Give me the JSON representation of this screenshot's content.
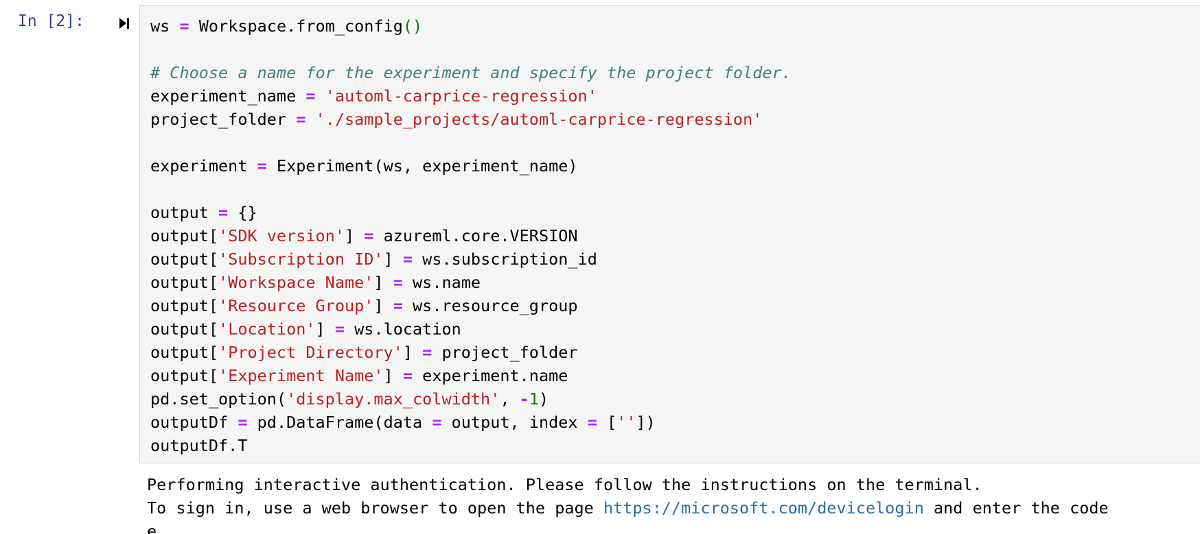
{
  "cell": {
    "prompt": "In [2]:",
    "run_icon": "run-cell-icon"
  },
  "code": {
    "l1": {
      "a": "ws ",
      "op": "=",
      "b": " Workspace.from_config",
      "p": "()"
    },
    "l3": "# Choose a name for the experiment and specify the project folder.",
    "l4": {
      "a": "experiment_name ",
      "op": "=",
      "s": "'automl-carprice-regression'"
    },
    "l5": {
      "a": "project_folder ",
      "op": "=",
      "s": "'./sample_projects/automl-carprice-regression'"
    },
    "l7": {
      "a": "experiment ",
      "op": "=",
      "b": " Experiment(ws, experiment_name)"
    },
    "l9": {
      "a": "output ",
      "op": "=",
      "b": " {}"
    },
    "l10": {
      "a": "output[",
      "s": "'SDK version'",
      "c": "] ",
      "op": "=",
      "b": " azureml.core.VERSION"
    },
    "l11": {
      "a": "output[",
      "s": "'Subscription ID'",
      "c": "] ",
      "op": "=",
      "b": " ws.subscription_id"
    },
    "l12": {
      "a": "output[",
      "s": "'Workspace Name'",
      "c": "] ",
      "op": "=",
      "b": " ws.name"
    },
    "l13": {
      "a": "output[",
      "s": "'Resource Group'",
      "c": "] ",
      "op": "=",
      "b": " ws.resource_group"
    },
    "l14": {
      "a": "output[",
      "s": "'Location'",
      "c": "] ",
      "op": "=",
      "b": " ws.location"
    },
    "l15": {
      "a": "output[",
      "s": "'Project Directory'",
      "c": "] ",
      "op": "=",
      "b": " project_folder"
    },
    "l16": {
      "a": "output[",
      "s": "'Experiment Name'",
      "c": "] ",
      "op": "=",
      "b": " experiment.name"
    },
    "l17": {
      "a": "pd.set_option(",
      "s": "'display.max_colwidth'",
      "c": ", ",
      "op": "-",
      "n": "1",
      "d": ")"
    },
    "l18": {
      "a": "outputDf ",
      "op": "=",
      "b": " pd.DataFrame(data ",
      "op2": "=",
      "c": " output, index ",
      "op3": "=",
      "d": " [",
      "s": "''",
      "e": "])"
    },
    "l19": "outputDf.T"
  },
  "output": {
    "line1": "Performing interactive authentication. Please follow the instructions on the terminal.",
    "line2_a": "To sign in, use a web browser to open the page ",
    "line2_link": "https://microsoft.com/devicelogin",
    "line2_b": " and enter the code",
    "line3": "e"
  }
}
